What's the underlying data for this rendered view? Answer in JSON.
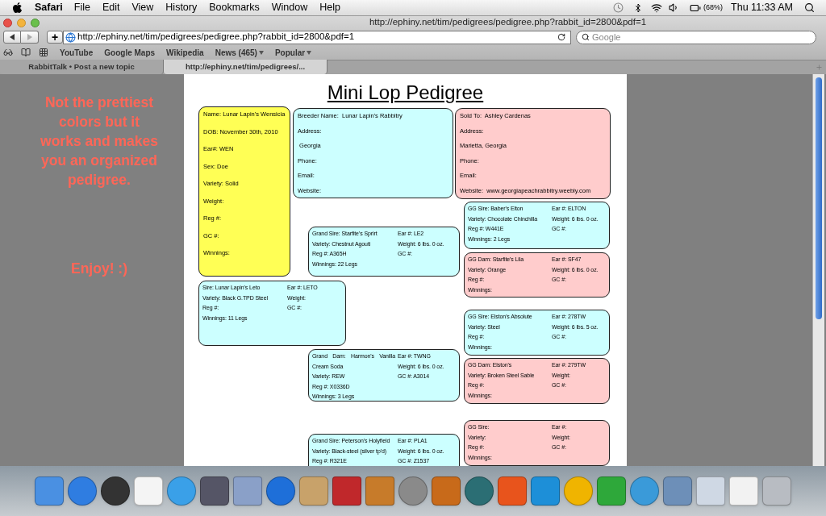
{
  "menu_bar": {
    "app": "Safari",
    "menus": [
      "File",
      "Edit",
      "View",
      "History",
      "Bookmarks",
      "Window",
      "Help"
    ],
    "battery": "(68%)",
    "clock": "Thu 11:33 AM"
  },
  "window": {
    "title": "http://ephiny.net/tim/pedigrees/pedigree.php?rabbit_id=2800&pdf=1"
  },
  "toolbar": {
    "new_tab_button": "+",
    "url": "http://ephiny.net/tim/pedigrees/pedigree.php?rabbit_id=2800&pdf=1",
    "search": {
      "placeholder": "Google"
    }
  },
  "bookmarks": [
    {
      "label": "YouTube",
      "has_menu": false
    },
    {
      "label": "Google Maps",
      "has_menu": false
    },
    {
      "label": "Wikipedia",
      "has_menu": false
    },
    {
      "label": "News (465)",
      "has_menu": true
    },
    {
      "label": "Popular",
      "has_menu": true
    }
  ],
  "tabs": [
    {
      "label": "RabbitTalk • Post a new topic",
      "selected": false
    },
    {
      "label": "http://ephiny.net/tim/pedigrees/...",
      "selected": true
    }
  ],
  "side_note": {
    "message": "Not the prettiest colors but it works and makes you an organized pedigree.",
    "signoff": "Enjoy! :)"
  },
  "pedigree": {
    "title": "Mini Lop Pedigree",
    "boxes": [
      {
        "kind": "list",
        "color": "#ffff55",
        "lines": [
          "Name: Lunar Lapin's Wensicia",
          "DOB: November 30th, 2010",
          "Ear#: WEN",
          "Sex: Doe",
          "Variety: Solid",
          "Weight:",
          "Reg #:",
          "GC #:",
          "Winnings:"
        ]
      },
      {
        "kind": "list",
        "color": "#ccffff",
        "lines": [
          "Breeder Name:  Lunar Lapin's Rabbitry",
          "Address:",
          " Georgia",
          "Phone:",
          "Email:",
          "Website:"
        ]
      },
      {
        "kind": "list",
        "color": "#ffcccc",
        "lines": [
          "Sold To:  Ashley Cardenas",
          "Address:",
          "Marietta, Georgia",
          "Phone:",
          "Email:",
          "Website:  www.georgiapeachrabbitry.weebly.com"
        ]
      },
      {
        "kind": "columns",
        "color": "#ccffff",
        "left": [
          "GG Sire: Baber's Elton",
          "Variety: Chocolate Chinchilla",
          "Reg #: W441E",
          "Winnings: 2 Legs"
        ],
        "right": [
          "Ear #: ELTON",
          "Weight: 6 lbs. 0 oz.",
          "GC #:"
        ]
      },
      {
        "kind": "columns",
        "color": "#ccffff",
        "left": [
          "Grand Sire: Starfite's Sprirt",
          "Variety: Chestnut Agouti",
          "Reg #: A365H",
          "Winnings: 22 Legs"
        ],
        "right": [
          "Ear #: LE2",
          "Weight: 6 lbs. 0 oz.",
          "GC #:"
        ]
      },
      {
        "kind": "columns",
        "color": "#ffcccc",
        "left": [
          "GG Dam: Starfite's Lila",
          "Variety: Orange",
          "Reg #:",
          "Winnings:"
        ],
        "right": [
          "Ear #: SF47",
          "Weight: 6 lbs. 0 oz.",
          "GC #:"
        ]
      },
      {
        "kind": "columns",
        "color": "#ccffff",
        "left": [
          "Sire: Lunar Lapin's Leto",
          "Variety: Black G.TPD Steel",
          "Reg #:",
          "Winnings: 11 Legs"
        ],
        "right": [
          "Ear #: LETO",
          "Weight:",
          "GC #:"
        ]
      },
      {
        "kind": "columns",
        "color": "#ccffff",
        "left": [
          "GG Sire: Elston's Absolute",
          "Variety: Steel",
          "Reg #:",
          "Winnings:"
        ],
        "right": [
          "Ear #: 278TW",
          "Weight: 6 lbs. 5 oz.",
          "GC #:"
        ]
      },
      {
        "kind": "columns",
        "color": "#ccffff",
        "left": [
          "Grand Dam: Harmon's Vanilla Cream Soda",
          "Variety: REW",
          "Reg #: X0336D",
          "Winnings: 3 Legs"
        ],
        "right": [
          "Ear #: TWNG",
          "Weight: 6 lbs. 0 oz.",
          "GC #: A3014"
        ]
      },
      {
        "kind": "columns",
        "color": "#ffcccc",
        "left": [
          "GG Dam: Elston's",
          "Variety: Broken Steel Sable",
          "Reg #:",
          "Winnings:"
        ],
        "right": [
          "Ear #: 279TW",
          "Weight:",
          "GC #:"
        ]
      },
      {
        "kind": "columns",
        "color": "#ffcccc",
        "left": [
          "GG Sire:",
          "Variety:",
          "Reg #:",
          "Winnings:"
        ],
        "right": [
          "Ear #:",
          "Weight:",
          "GC #:"
        ]
      },
      {
        "kind": "columns",
        "color": "#ccffff",
        "left": [
          "Grand Sire: Peterson's Holyfield",
          "Variety: Black-steel (silver tp'd)",
          "Reg #: R321E"
        ],
        "right": [
          "Ear #: PLA1",
          "Weight: 6 lbs. 0 oz.",
          "GC #: Z1537"
        ]
      }
    ]
  }
}
